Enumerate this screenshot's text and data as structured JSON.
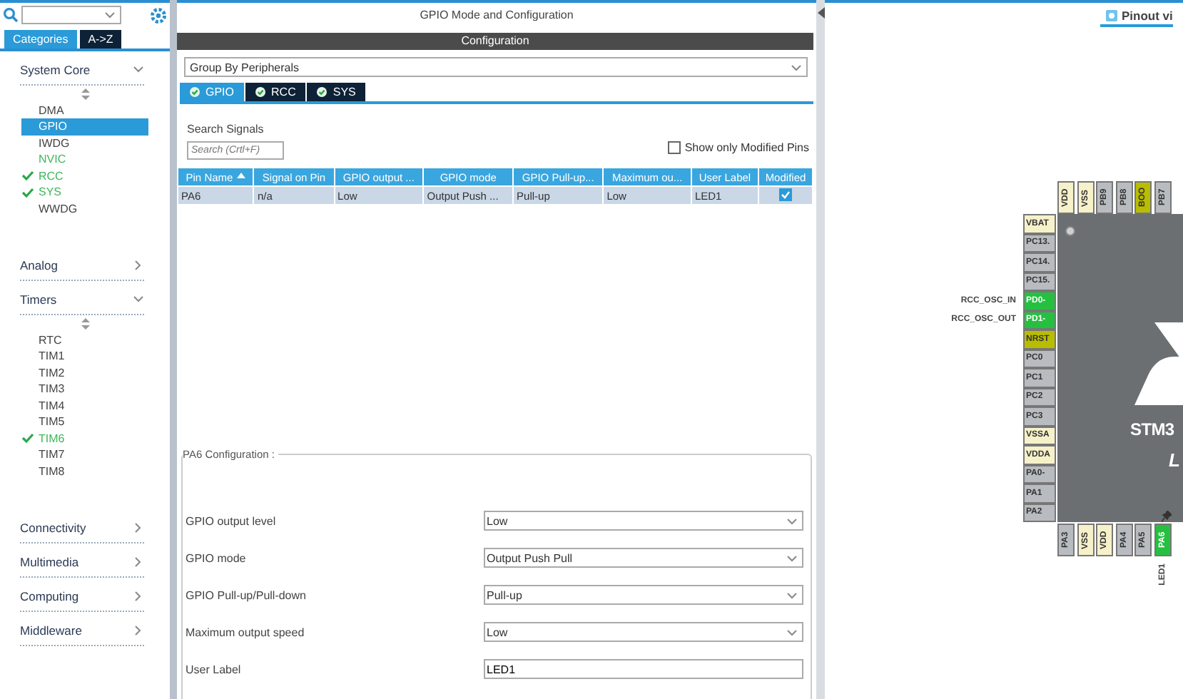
{
  "sidebar": {
    "tabs": [
      {
        "label": "Categories",
        "selected": true
      },
      {
        "label": "A->Z",
        "selected": false
      }
    ],
    "categories": [
      {
        "name": "System Core",
        "expanded": true,
        "items": [
          {
            "label": "DMA",
            "selected": false,
            "configured": false,
            "checked": false
          },
          {
            "label": "GPIO",
            "selected": true,
            "configured": false,
            "checked": false
          },
          {
            "label": "IWDG",
            "selected": false,
            "configured": false,
            "checked": false
          },
          {
            "label": "NVIC",
            "selected": false,
            "configured": true,
            "checked": false
          },
          {
            "label": "RCC",
            "selected": false,
            "configured": true,
            "checked": true
          },
          {
            "label": "SYS",
            "selected": false,
            "configured": true,
            "checked": true
          },
          {
            "label": "WWDG",
            "selected": false,
            "configured": false,
            "checked": false
          }
        ]
      },
      {
        "name": "Analog",
        "expanded": false
      },
      {
        "name": "Timers",
        "expanded": true,
        "items": [
          {
            "label": "RTC",
            "selected": false,
            "configured": false,
            "checked": false
          },
          {
            "label": "TIM1",
            "selected": false,
            "configured": false,
            "checked": false
          },
          {
            "label": "TIM2",
            "selected": false,
            "configured": false,
            "checked": false
          },
          {
            "label": "TIM3",
            "selected": false,
            "configured": false,
            "checked": false
          },
          {
            "label": "TIM4",
            "selected": false,
            "configured": false,
            "checked": false
          },
          {
            "label": "TIM5",
            "selected": false,
            "configured": false,
            "checked": false
          },
          {
            "label": "TIM6",
            "selected": false,
            "configured": true,
            "checked": true
          },
          {
            "label": "TIM7",
            "selected": false,
            "configured": false,
            "checked": false
          },
          {
            "label": "TIM8",
            "selected": false,
            "configured": false,
            "checked": false
          }
        ]
      },
      {
        "name": "Connectivity",
        "expanded": false
      },
      {
        "name": "Multimedia",
        "expanded": false
      },
      {
        "name": "Computing",
        "expanded": false
      },
      {
        "name": "Middleware",
        "expanded": false
      }
    ]
  },
  "panel": {
    "title": "GPIO Mode and Configuration",
    "section": "Configuration",
    "group_by": "Group By Peripherals",
    "tabs": [
      {
        "label": "GPIO",
        "selected": true
      },
      {
        "label": "RCC",
        "selected": false
      },
      {
        "label": "SYS",
        "selected": false
      }
    ],
    "search_label": "Search Signals",
    "search": {
      "placeholder": "Search (Crtl+F)"
    },
    "modified_filter": {
      "label": "Show only Modified Pins",
      "checked": false
    },
    "table": {
      "columns": [
        "Pin Name",
        "Signal on Pin",
        "GPIO output ...",
        "GPIO mode",
        "GPIO Pull-up...",
        "Maximum ou...",
        "User Label",
        "Modified"
      ],
      "rows": [
        {
          "cells": [
            "PA6",
            "n/a",
            "Low",
            "Output Push ...",
            "Pull-up",
            "Low",
            "LED1"
          ],
          "modified": true,
          "selected": true
        }
      ]
    },
    "pin_config": {
      "title": "PA6 Configuration :",
      "fields": [
        {
          "label": "GPIO output level",
          "kind": "select",
          "value": "Low"
        },
        {
          "label": "GPIO mode",
          "kind": "select",
          "value": "Output Push Pull"
        },
        {
          "label": "GPIO Pull-up/Pull-down",
          "kind": "select",
          "value": "Pull-up"
        },
        {
          "label": "Maximum output speed",
          "kind": "select",
          "value": "Low"
        },
        {
          "label": "User Label",
          "kind": "text",
          "value": "LED1"
        }
      ]
    }
  },
  "pinout": {
    "tab": "Pinout vi",
    "chip": {
      "name": "STM3",
      "subname": "L",
      "top_pins": [
        {
          "label": "VDD",
          "kind": "power"
        },
        {
          "label": "VSS",
          "kind": "power"
        },
        {
          "label": "PB9",
          "kind": "io"
        },
        {
          "label": "PB8",
          "kind": "io"
        },
        {
          "label": "BOO",
          "kind": "boot"
        },
        {
          "label": "PB7",
          "kind": "io"
        }
      ],
      "left_pins": [
        {
          "label": "VBAT",
          "kind": "power"
        },
        {
          "label": "PC13.",
          "kind": "io"
        },
        {
          "label": "PC14.",
          "kind": "io"
        },
        {
          "label": "PC15.",
          "kind": "io"
        },
        {
          "label": "PD0-",
          "kind": "assigned",
          "signal": "RCC_OSC_IN"
        },
        {
          "label": "PD1-",
          "kind": "assigned",
          "signal": "RCC_OSC_OUT"
        },
        {
          "label": "NRST",
          "kind": "reset"
        },
        {
          "label": "PC0",
          "kind": "io"
        },
        {
          "label": "PC1",
          "kind": "io"
        },
        {
          "label": "PC2",
          "kind": "io"
        },
        {
          "label": "PC3",
          "kind": "io"
        },
        {
          "label": "VSSA",
          "kind": "power"
        },
        {
          "label": "VDDA",
          "kind": "power"
        },
        {
          "label": "PA0-",
          "kind": "io"
        },
        {
          "label": "PA1",
          "kind": "io"
        },
        {
          "label": "PA2",
          "kind": "io"
        }
      ],
      "bottom_pins": [
        {
          "label": "PA3",
          "kind": "io",
          "pinned": false
        },
        {
          "label": "VSS",
          "kind": "power",
          "pinned": false
        },
        {
          "label": "VDD",
          "kind": "power",
          "pinned": false
        },
        {
          "label": "PA4",
          "kind": "io",
          "pinned": false
        },
        {
          "label": "PA5",
          "kind": "io",
          "pinned": false
        },
        {
          "label": "PA6",
          "kind": "assigned",
          "signal": "LED1",
          "pinned": true
        }
      ]
    }
  }
}
